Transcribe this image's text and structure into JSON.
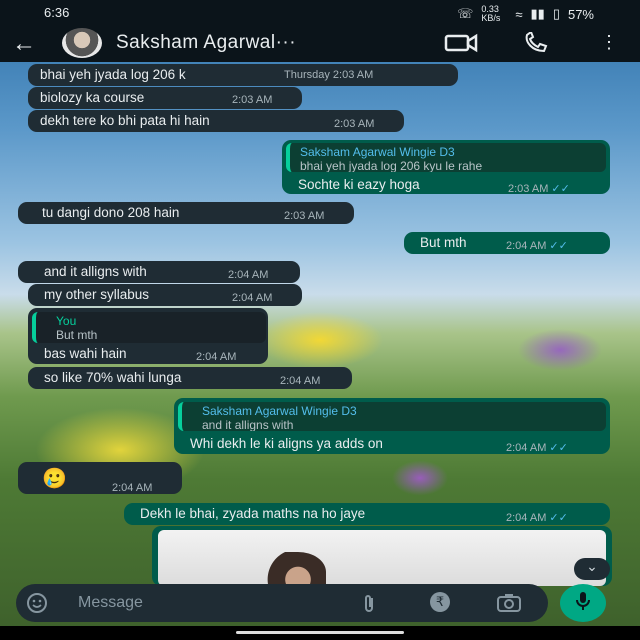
{
  "status_bar": {
    "time": "6:36",
    "speed": "0.33 KB/s",
    "battery": "57%"
  },
  "header": {
    "contact_name": "Saksham Agarwal···"
  },
  "messages": [
    {
      "text": "bhai yeh jyada log 206 k",
      "time": "Thursday   2:03 AM"
    },
    {
      "text": "biolozy ka course",
      "time": "2:03 AM"
    },
    {
      "text": "dekh tere ko bhi pata hi hain",
      "time": "2:03 AM"
    },
    {
      "quote_name": "Saksham Agarwal Wingie D3",
      "quote_text": "bhai yeh jyada log 206 kyu le rahe",
      "text": "Sochte ki eazy hoga",
      "time": "2:03 AM"
    },
    {
      "text": "tu dangi dono 208 hain",
      "time": "2:03 AM"
    },
    {
      "text": "But mth",
      "time": "2:04 AM"
    },
    {
      "text": "and it alligns with",
      "time": "2:04 AM"
    },
    {
      "text": "my other syllabus",
      "time": "2:04 AM"
    },
    {
      "quote_name": "You",
      "quote_text": "But mth",
      "text": "bas wahi hain",
      "time": "2:04 AM"
    },
    {
      "text": "so like 70% wahi lunga",
      "time": "2:04 AM"
    },
    {
      "quote_name": "Saksham Agarwal Wingie D3",
      "quote_text": "and it alligns with",
      "text": "Whi dekh le ki aligns ya adds on",
      "time": "2:04 AM"
    },
    {
      "text": "🥲",
      "time": "2:04 AM"
    },
    {
      "text": "Dekh le bhai, zyada maths na ho jaye",
      "time": "2:04 AM"
    }
  ],
  "composer": {
    "placeholder": "Message"
  },
  "icons": {
    "back": "back-arrow-icon",
    "video": "video-call-icon",
    "call": "voice-call-icon",
    "menu": "more-vert-icon",
    "emoji": "emoji-icon",
    "attach": "attach-icon",
    "payment": "rupee-icon",
    "camera": "camera-icon",
    "mic": "mic-icon"
  },
  "colors": {
    "incoming": "#1f2c34",
    "outgoing": "#005c4b",
    "accent": "#00a884",
    "read_tick": "#53bdeb"
  }
}
